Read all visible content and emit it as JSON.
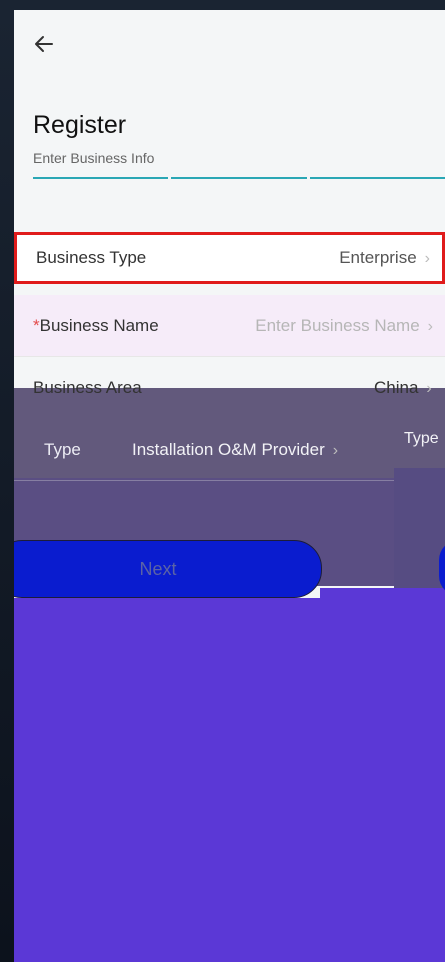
{
  "header": {
    "back_icon": "arrow-left-icon"
  },
  "title": "Register",
  "subtitle": "Enter Business Info",
  "fields": {
    "business_type": {
      "label": "Business Type",
      "value": "Enterprise"
    },
    "business_name": {
      "required_mark": "*",
      "label": "Business Name",
      "placeholder": "Enter Business Name"
    },
    "business_area": {
      "label": "Business Area",
      "value": "China"
    },
    "type": {
      "label": "Type",
      "value": "Installation O&M Provider",
      "overflow_label": "Type"
    }
  },
  "actions": {
    "next_label": "Next"
  },
  "colors": {
    "accent": "#2aa7b5",
    "highlight_border": "#e01b1b",
    "button": "#0a1ccf",
    "overlay": "#5b38d6"
  }
}
